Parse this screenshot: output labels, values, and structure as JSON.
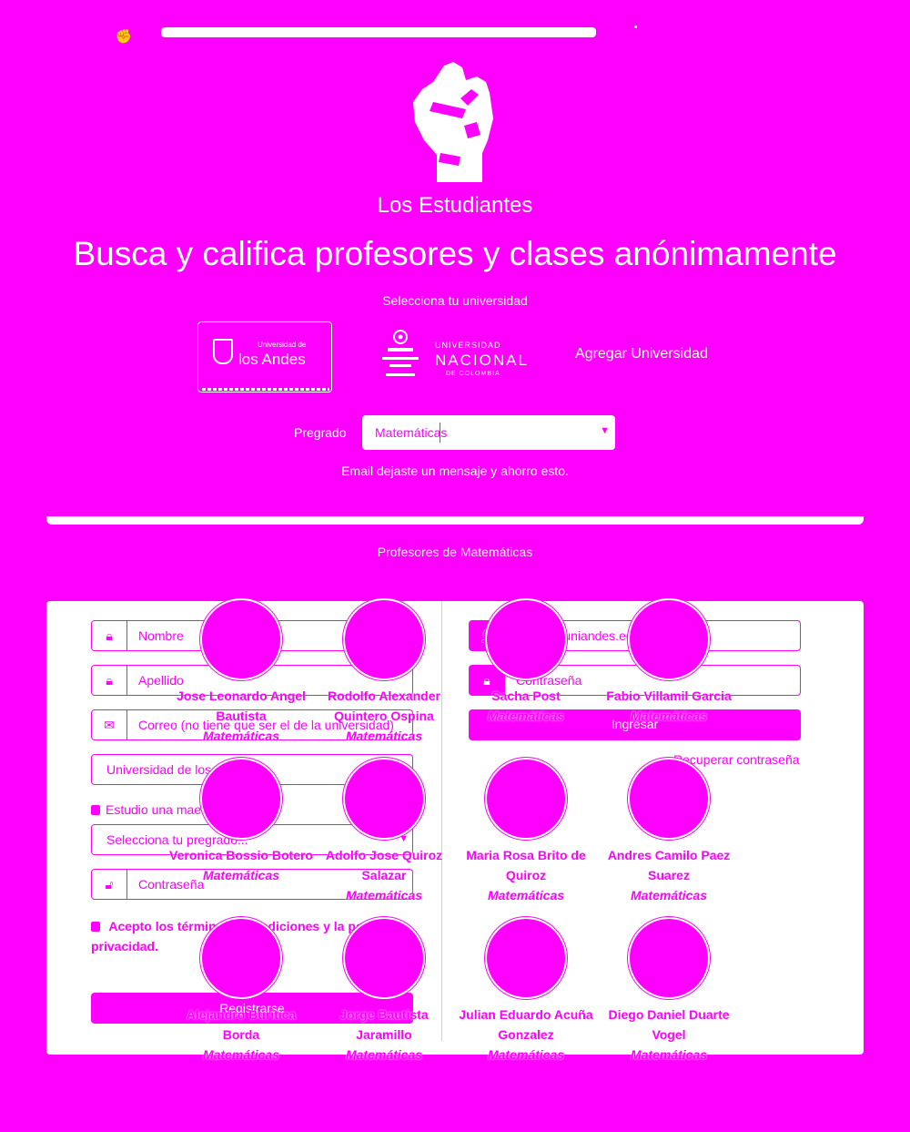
{
  "nav": {
    "logo_icon": "fist-icon"
  },
  "hero": {
    "brand": "Los Estudiantes",
    "headline": "Busca y califica profesores y clases anónimamente",
    "select_university_label": "Selecciona tu universidad",
    "universities": [
      {
        "small": "Universidad de",
        "name": "los Andes"
      },
      {
        "top": "UNIVERSIDAD",
        "name": "NACIONAL",
        "sub": "DE COLOMBIA"
      }
    ],
    "add_university": "Agregar Universidad",
    "pregrado_label": "Pregrado",
    "pregrado_value": "Matemáticas",
    "note": "Email dejaste un mensaje y ahorro esto."
  },
  "section_title": "Profesores de Matemáticas",
  "register": {
    "name_placeholder": "Nombre",
    "lastname_placeholder": "Apellido",
    "email_placeholder": "Correo (no tiene que ser el de la universidad)",
    "university_value": "Universidad de los Andes",
    "masters_label": "Estudio una maestría",
    "pregrado_placeholder": "Selecciona tu pregrado...",
    "password_placeholder": "Contraseña",
    "terms": "Acepto los términos y condiciones y la política de privacidad.",
    "submit": "Registrarse"
  },
  "login": {
    "email_placeholder": "fulano@uniandes.edu.co",
    "password_placeholder": "Contraseña",
    "submit": "Ingresar",
    "recover": "Recuperar contraseña"
  },
  "professors": [
    {
      "name": "Jose Leonardo Angel Bautista",
      "dept": "Matemáticas"
    },
    {
      "name": "Rodolfo Alexander Quintero Ospina",
      "dept": "Matemáticas"
    },
    {
      "name": "Sacha Post",
      "dept": "Matemáticas"
    },
    {
      "name": "Fabio Villamil Garcia",
      "dept": "Matemáticas"
    },
    {
      "name": "Veronica Bossio Botero",
      "dept": "Matemáticas"
    },
    {
      "name": "Adolfo Jose Quiroz Salazar",
      "dept": "Matemáticas"
    },
    {
      "name": "Maria Rosa Brito de Quiroz",
      "dept": "Matemáticas"
    },
    {
      "name": "Andres Camilo Paez Suarez",
      "dept": "Matemáticas"
    },
    {
      "name": "Alejandro Buritica Borda",
      "dept": "Matemáticas"
    },
    {
      "name": "Jorge Bautista Jaramillo",
      "dept": "Matemáticas"
    },
    {
      "name": "Julian Eduardo Acuña Gonzalez",
      "dept": "Matemáticas"
    },
    {
      "name": "Diego Daniel Duarte Vogel",
      "dept": "Matemáticas"
    }
  ],
  "colors": {
    "accent": "#ff00ff",
    "surface": "#ffffff"
  }
}
